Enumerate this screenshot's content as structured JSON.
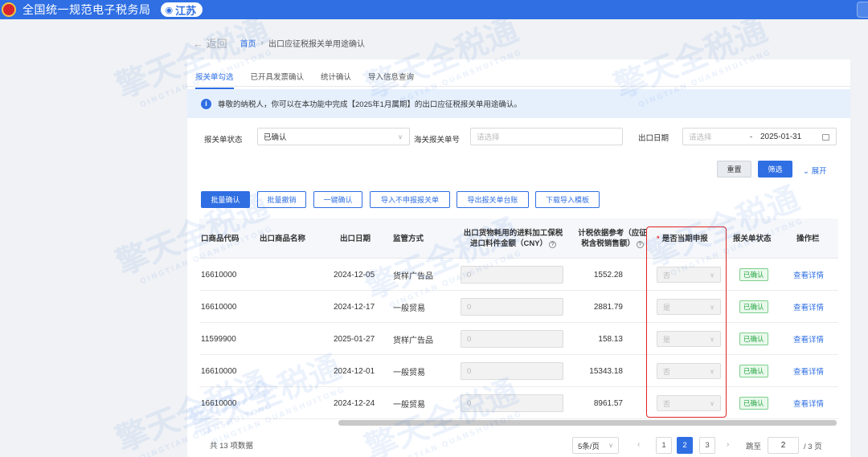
{
  "header": {
    "site_title": "全国统一规范电子税务局",
    "region": "江苏",
    "pin_icon": "location-pin-icon"
  },
  "breadcrumb": {
    "back": "← 返回",
    "home": "首页",
    "separator": "›",
    "current": "出口应征税报关单用途确认"
  },
  "tabs": [
    {
      "label": "报关单勾选",
      "active": true
    },
    {
      "label": "已开具发票确认",
      "active": false
    },
    {
      "label": "统计确认",
      "active": false
    },
    {
      "label": "导入信息查询",
      "active": false
    }
  ],
  "notice": {
    "icon": "info-icon",
    "text": "尊敬的纳税人，你可以在本功能中完成【2025年1月属期】的出口应征税报关单用途确认。"
  },
  "filters": {
    "status_label": "报关单状态",
    "status_value": "已确认",
    "customs_no_label": "海关报关单号",
    "customs_no_placeholder": "请选择",
    "export_date_label": "出口日期",
    "date_start_placeholder": "请选择",
    "date_separator": "-",
    "date_end": "2025-01-31"
  },
  "actions": {
    "reset": "重置",
    "query": "筛选",
    "expand": "⌄ 展开",
    "batch_confirm": "批量确认",
    "batch_revoke": "批量撤销",
    "one_click_confirm": "一键确认",
    "import_not_declared": "导入不申报报关单",
    "export_ledger": "导出报关单台账",
    "download_template": "下载导入模板"
  },
  "table": {
    "headers": {
      "goods_code": "口商品代码",
      "goods_name": "出口商品名称",
      "export_date": "出口日期",
      "supervision": "监管方式",
      "material_amount_line1": "出口货物耗用的进料加工保税",
      "material_amount_line2": "进口料件金额（CNY）",
      "tax_basis_line1": "计税依据参考（应征",
      "tax_basis_line2": "税含税销售额）",
      "required_mark": "*",
      "current_declare": "是否当期申报",
      "decl_status": "报关单状态",
      "operation": "操作栏"
    },
    "rows": [
      {
        "code": "16610000",
        "name": "",
        "date": "2024-12-05",
        "method": "货样广告品",
        "amount": "0",
        "tax_basis": "1552.28",
        "declare": "否",
        "status": "已确认",
        "action": "查看详情"
      },
      {
        "code": "16610000",
        "name": "",
        "date": "2024-12-17",
        "method": "一般贸易",
        "amount": "0",
        "tax_basis": "2881.79",
        "declare": "是",
        "status": "已确认",
        "action": "查看详情"
      },
      {
        "code": "11599900",
        "name": "",
        "date": "2025-01-27",
        "method": "货样广告品",
        "amount": "0",
        "tax_basis": "158.13",
        "declare": "是",
        "status": "已确认",
        "action": "查看详情"
      },
      {
        "code": "16610000",
        "name": "",
        "date": "2024-12-01",
        "method": "一般贸易",
        "amount": "0",
        "tax_basis": "15343.18",
        "declare": "否",
        "status": "已确认",
        "action": "查看详情"
      },
      {
        "code": "16610000",
        "name": "",
        "date": "2024-12-24",
        "method": "一般贸易",
        "amount": "0",
        "tax_basis": "8961.57",
        "declare": "否",
        "status": "已确认",
        "action": "查看详情"
      }
    ]
  },
  "pagination": {
    "total": "共 13 项数据",
    "page_size": "5条/页",
    "prev": "‹",
    "next": "›",
    "pages": [
      "1",
      "2",
      "3"
    ],
    "current_page": "2",
    "jump_label": "跳至",
    "jump_value": "2",
    "total_pages": "/ 3 页"
  },
  "watermark": {
    "text": "擎天全税通",
    "sub": "QINGTIAN QUANSHUITONG"
  },
  "colors": {
    "brand": "#2f6fe3",
    "highlight": "#e02424",
    "status_green": "#2aa745"
  }
}
